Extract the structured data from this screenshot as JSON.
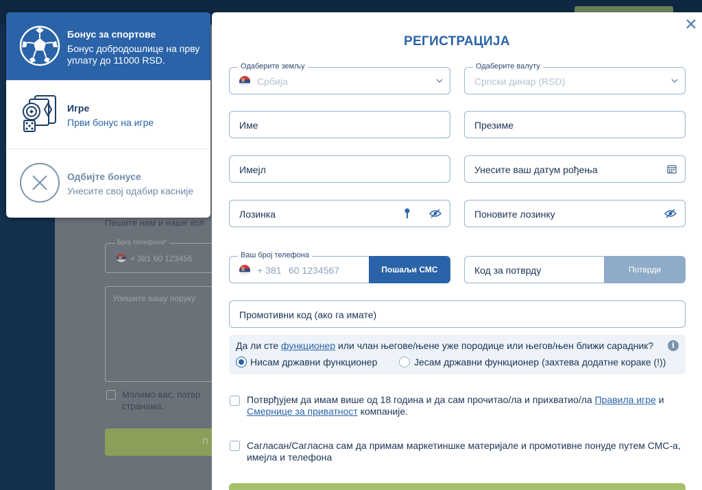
{
  "bonus_panel": {
    "items": [
      {
        "title": "Бонус за спортове",
        "desc": "Бонус добродошлице на прву уплату до 11000 RSD.",
        "icon": "soccer-ball-icon",
        "active": true
      },
      {
        "title": "Игре",
        "desc": "Први бонус на игре",
        "icon": "casino-cards-icon",
        "active": false
      },
      {
        "title": "Одбијте бонусе",
        "desc": "Унесите свој одабир касније",
        "icon": "decline-icon",
        "active": false
      }
    ]
  },
  "background": {
    "contact_text": "Пишите нам и наше кол",
    "phone_label": "Број телефона*",
    "phone_value": "+ 381   60 123456",
    "message_placeholder": "Упишите вашу поруку",
    "consent_text_line1": "Молимо вас, потвр",
    "consent_text_line2": "странама.",
    "button_text": "П"
  },
  "modal": {
    "title": "РЕГИСТРАЦИЈА",
    "country": {
      "label": "Одаберите земљу",
      "value": "Србија"
    },
    "currency": {
      "label": "Одаберите валуту",
      "value": "Српски динар (RSD)"
    },
    "first_name": {
      "placeholder": "Име"
    },
    "last_name": {
      "placeholder": "Презиме"
    },
    "email": {
      "placeholder": "Имејл"
    },
    "birthdate": {
      "placeholder": "Унесите ваш датум рођења"
    },
    "password": {
      "placeholder": "Лозинка"
    },
    "password_repeat": {
      "placeholder": "Поновите лозинку"
    },
    "phone": {
      "label": "Ваш број телефона",
      "code": "+ 381",
      "placeholder": "60 1234567"
    },
    "send_sms_label": "Пошаљи СМС",
    "verify_code": {
      "placeholder": "Код за потврду"
    },
    "confirm_label": "Потврди",
    "promo": {
      "placeholder": "Промотивни код (ако га имате)"
    },
    "pep": {
      "question_before": "Да ли сте ",
      "question_link": "функционер",
      "question_after": " или члан његове/њене уже породице или његов/њен ближи сарадник?",
      "info_glyph": "i",
      "option_no": "Нисам државни функционер",
      "option_yes": "Јесам државни функционер (захтева додатне кораке (!))",
      "selected": "no"
    },
    "terms": {
      "text_before": "Потврђујем да имам више од 18 година и да сам прочитао/ла и прихватио/ла ",
      "link1": "Правила игре",
      "text_mid": " и ",
      "link2": "Смернице за приватност",
      "text_after": " компаније."
    },
    "marketing": {
      "text": "Сагласан/Сагласна сам да примам маркетиншке материјале и промотивне понуде путем СМС-а, имејла и телефона"
    },
    "close_glyph": "×",
    "colors": {
      "primary": "#2a63a7",
      "border": "#9ab1cb",
      "submit": "#a6c06e",
      "confirm_disabled": "#8eabc8"
    }
  }
}
